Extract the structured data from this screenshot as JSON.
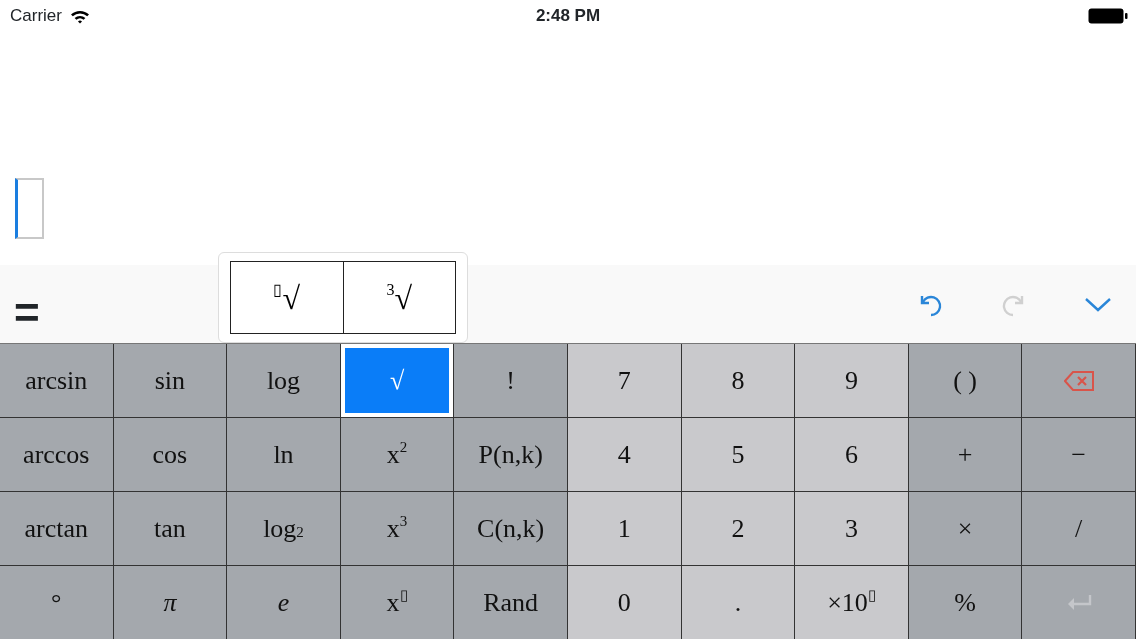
{
  "status_bar": {
    "carrier": "Carrier",
    "time": "2:48 PM"
  },
  "editor": {
    "result_sign": "=",
    "undo": {
      "disabled": false
    },
    "redo": {
      "disabled": true
    }
  },
  "popup": {
    "options": [
      {
        "label": "$^{▯}$√"
      },
      {
        "label": "$^{3}$√"
      }
    ]
  },
  "keys": [
    {
      "label": "arcsin",
      "kind": "func",
      "selected": false
    },
    {
      "label": "sin",
      "kind": "func",
      "selected": false
    },
    {
      "label": "log",
      "kind": "func",
      "selected": false
    },
    {
      "label": "√",
      "kind": "func",
      "selected": true
    },
    {
      "label": "!",
      "kind": "func",
      "selected": false
    },
    {
      "label": "7",
      "kind": "digit",
      "selected": false
    },
    {
      "label": "8",
      "kind": "digit",
      "selected": false
    },
    {
      "label": "9",
      "kind": "digit",
      "selected": false
    },
    {
      "label": "( )",
      "kind": "op",
      "selected": false
    },
    {
      "kind": "backspace",
      "selected": false
    },
    {
      "label": "arccos",
      "kind": "func",
      "selected": false
    },
    {
      "label": "cos",
      "kind": "func",
      "selected": false
    },
    {
      "label": "ln",
      "kind": "func",
      "selected": false
    },
    {
      "label": "x$^{2}$",
      "kind": "func",
      "selected": false
    },
    {
      "label": "P(n,k)",
      "kind": "func",
      "selected": false
    },
    {
      "label": "4",
      "kind": "digit",
      "selected": false
    },
    {
      "label": "5",
      "kind": "digit",
      "selected": false
    },
    {
      "label": "6",
      "kind": "digit",
      "selected": false
    },
    {
      "label": "+",
      "kind": "op",
      "selected": false
    },
    {
      "label": "−",
      "kind": "op",
      "selected": false
    },
    {
      "label": "arctan",
      "kind": "func",
      "selected": false
    },
    {
      "label": "tan",
      "kind": "func",
      "selected": false
    },
    {
      "label": "log$_{2}$",
      "kind": "func",
      "selected": false
    },
    {
      "label": "x$^{3}$",
      "kind": "func",
      "selected": false
    },
    {
      "label": "C(n,k)",
      "kind": "func",
      "selected": false
    },
    {
      "label": "1",
      "kind": "digit",
      "selected": false
    },
    {
      "label": "2",
      "kind": "digit",
      "selected": false
    },
    {
      "label": "3",
      "kind": "digit",
      "selected": false
    },
    {
      "label": "×",
      "kind": "op",
      "selected": false
    },
    {
      "label": "/",
      "kind": "op",
      "selected": false
    },
    {
      "label": "°",
      "kind": "func",
      "selected": false
    },
    {
      "label": "*π*",
      "kind": "func",
      "selected": false
    },
    {
      "label": "*e*",
      "kind": "func",
      "selected": false
    },
    {
      "label": "x$^{▯}$",
      "kind": "func",
      "selected": false
    },
    {
      "label": "Rand",
      "kind": "func",
      "selected": false
    },
    {
      "label": "0",
      "kind": "digit",
      "selected": false
    },
    {
      "label": ".",
      "kind": "digit",
      "selected": false
    },
    {
      "label": "×10$^{▯}$",
      "kind": "digit",
      "selected": false
    },
    {
      "label": "%",
      "kind": "op",
      "selected": false
    },
    {
      "kind": "enter",
      "disabled": true,
      "selected": false
    }
  ]
}
